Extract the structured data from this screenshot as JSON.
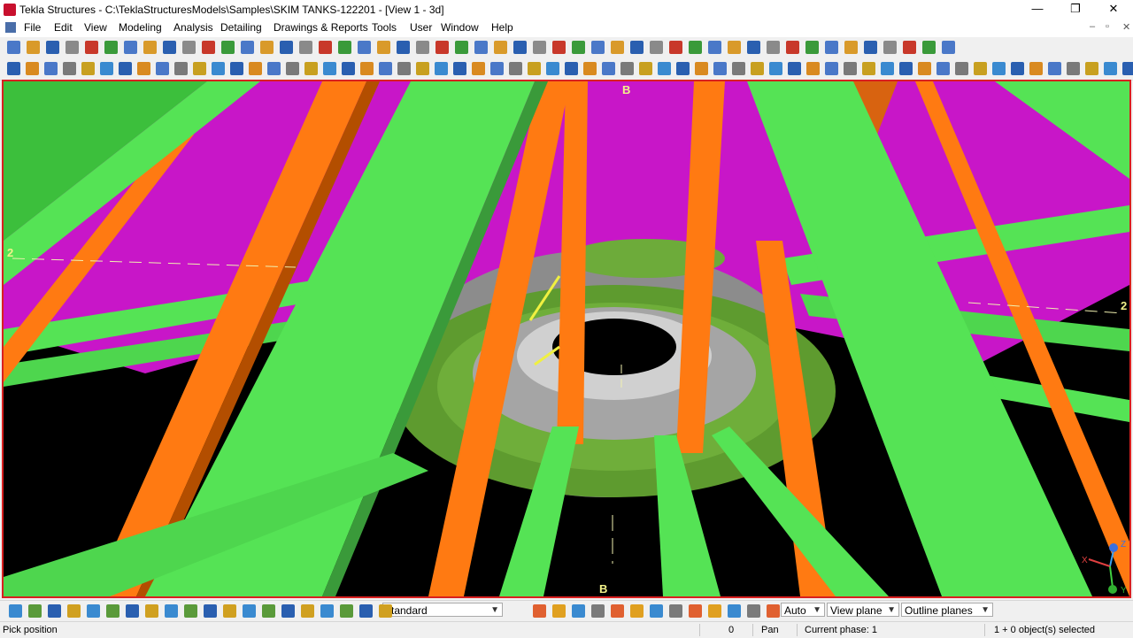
{
  "window": {
    "title": "Tekla Structures - C:\\TeklaStructuresModels\\Samples\\SKIM TANKS-122201 - [View 1 - 3d]",
    "minimize": "—",
    "maximize": "❐",
    "close": "✕"
  },
  "menu": {
    "items": [
      "File",
      "Edit",
      "View",
      "Modeling",
      "Analysis",
      "Detailing",
      "Drawings & Reports",
      "Tools",
      "User",
      "Window",
      "Help"
    ],
    "mdi_minimize": "–",
    "mdi_restore": "▫",
    "mdi_close": "✕"
  },
  "viewport": {
    "grid_labels": {
      "top_b": "B",
      "bottom_b": "B",
      "left_2": "2",
      "right_2": "2"
    },
    "axis": {
      "z": "Z",
      "x": "X",
      "y": "Y"
    },
    "colors": {
      "background": "#000000",
      "purple": "#c816c8",
      "green": "#55e355",
      "orange": "#ff7a12",
      "grey": "#9a9a9a",
      "olive": "#6dab3a"
    }
  },
  "bottom_toolbar": {
    "settings_select": "standard",
    "snap_depth": "Auto",
    "plane": "View plane",
    "snap_planes": "Outline planes"
  },
  "status": {
    "prompt": "Pick position",
    "value": "0",
    "mode": "Pan",
    "phase": "Current phase: 1",
    "selection": "1 + 0 object(s) selected"
  }
}
